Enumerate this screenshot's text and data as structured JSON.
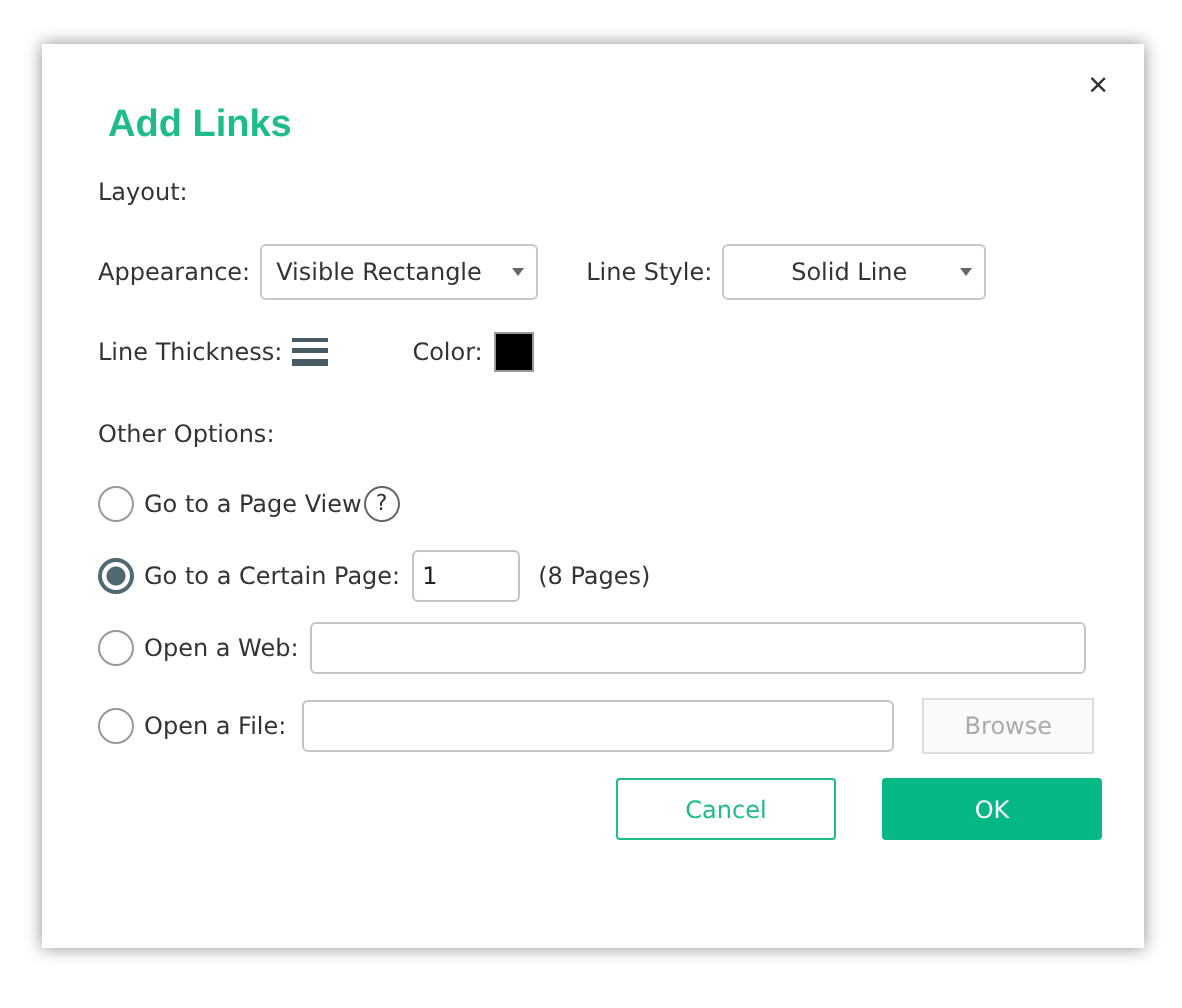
{
  "dialog": {
    "title": "Add Links",
    "close": "×"
  },
  "layout": {
    "heading": "Layout:",
    "appearance": {
      "label": "Appearance:",
      "value": "Visible Rectangle"
    },
    "line_style": {
      "label": "Line Style:",
      "value": "Solid Line"
    },
    "line_thickness": {
      "label": "Line Thickness:"
    },
    "color": {
      "label": "Color:",
      "color": "#000000"
    }
  },
  "other_options": {
    "heading": "Other Options:",
    "options": [
      {
        "kind": "help",
        "label": "Go to a Page View",
        "selected": false,
        "help": "?"
      },
      {
        "kind": "page",
        "label": "Go to a Certain Page:",
        "selected": true,
        "value": "1",
        "note": "(8 Pages)"
      },
      {
        "kind": "field",
        "label": "Open a Web:",
        "selected": false
      },
      {
        "kind": "file",
        "label": "Open a File:",
        "selected": false,
        "button": "Browse",
        "disabled": true
      }
    ]
  },
  "buttons": [
    {
      "kind": "secondary",
      "label": "Cancel"
    },
    {
      "kind": "primary",
      "label": "OK"
    }
  ]
}
